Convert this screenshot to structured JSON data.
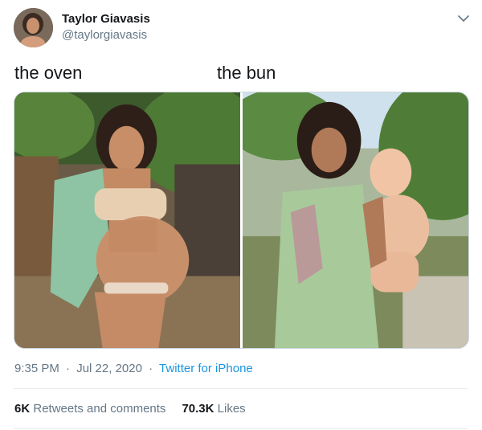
{
  "author": {
    "display_name": "Taylor Giavasis",
    "handle": "@taylorgiavasis"
  },
  "tweet": {
    "caption_left": "the oven",
    "caption_right": "the bun",
    "time": "9:35 PM",
    "separator": "·",
    "date": "Jul 22, 2020",
    "source": "Twitter for iPhone"
  },
  "stats": {
    "retweets_count": "6K",
    "retweets_label": "Retweets and comments",
    "likes_count": "70.3K",
    "likes_label": "Likes"
  },
  "icons": {
    "menu": "chevron-down-icon"
  },
  "colors": {
    "text_primary": "#14171a",
    "text_secondary": "#657786",
    "link": "#1b95e0",
    "border": "#ccd6dd"
  }
}
